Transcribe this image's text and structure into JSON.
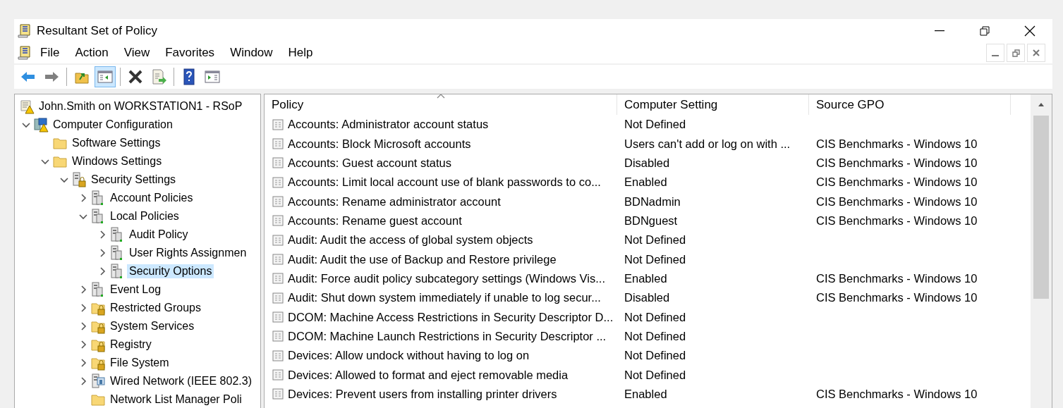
{
  "window": {
    "title": "Resultant Set of Policy"
  },
  "menu": [
    "File",
    "Action",
    "View",
    "Favorites",
    "Window",
    "Help"
  ],
  "toolbar": [
    [
      {
        "kind": "back",
        "selected": false
      },
      {
        "kind": "forward",
        "selected": false
      }
    ],
    [
      {
        "kind": "up",
        "selected": false
      },
      {
        "kind": "show-tree",
        "selected": true
      }
    ],
    [
      {
        "kind": "delete",
        "selected": false
      },
      {
        "kind": "export",
        "selected": false
      }
    ],
    [
      {
        "kind": "help",
        "selected": false
      },
      {
        "kind": "show-action",
        "selected": false
      }
    ]
  ],
  "tree": [
    {
      "label": "John.Smith on WORKSTATION1 - RSoP",
      "kind": "rsop",
      "selected": false,
      "children": [
        {
          "label": "Computer Configuration",
          "kind": "computer",
          "expanded": true,
          "selected": false,
          "children": [
            {
              "label": "Software Settings",
              "kind": "folder",
              "selected": false
            },
            {
              "label": "Windows Settings",
              "kind": "folder",
              "expanded": true,
              "selected": false,
              "children": [
                {
                  "label": "Security Settings",
                  "kind": "security",
                  "expanded": true,
                  "selected": false,
                  "children": [
                    {
                      "label": "Account Policies",
                      "kind": "policy",
                      "expanded": false,
                      "selected": false
                    },
                    {
                      "label": "Local Policies",
                      "kind": "policy",
                      "expanded": true,
                      "selected": false,
                      "children": [
                        {
                          "label": "Audit Policy",
                          "kind": "policy",
                          "expanded": false,
                          "selected": false
                        },
                        {
                          "label": "User Rights Assignmen",
                          "kind": "policy",
                          "expanded": false,
                          "selected": false
                        },
                        {
                          "label": "Security Options",
                          "kind": "policy",
                          "expanded": false,
                          "selected": true
                        }
                      ]
                    },
                    {
                      "label": "Event Log",
                      "kind": "policy",
                      "expanded": false,
                      "selected": false
                    },
                    {
                      "label": "Restricted Groups",
                      "kind": "locked-folder",
                      "expanded": false,
                      "selected": false
                    },
                    {
                      "label": "System Services",
                      "kind": "locked-folder",
                      "expanded": false,
                      "selected": false
                    },
                    {
                      "label": "Registry",
                      "kind": "locked-folder",
                      "expanded": false,
                      "selected": false
                    },
                    {
                      "label": "File System",
                      "kind": "locked-folder",
                      "expanded": false,
                      "selected": false
                    },
                    {
                      "label": "Wired Network (IEEE 802.3)",
                      "kind": "network",
                      "expanded": false,
                      "selected": false
                    },
                    {
                      "label": "Network List Manager Poli",
                      "kind": "folder",
                      "selected": false
                    }
                  ]
                }
              ]
            }
          ]
        }
      ]
    }
  ],
  "table": {
    "columns": [
      {
        "label": "Policy",
        "sorted": true
      },
      {
        "label": "Computer Setting",
        "sorted": false
      },
      {
        "label": "Source GPO",
        "sorted": false
      }
    ],
    "rows": [
      [
        "Accounts: Administrator account status",
        "Not Defined",
        ""
      ],
      [
        "Accounts: Block Microsoft accounts",
        "Users can't add or log on with ...",
        "CIS Benchmarks - Windows 10"
      ],
      [
        "Accounts: Guest account status",
        "Disabled",
        "CIS Benchmarks - Windows 10"
      ],
      [
        "Accounts: Limit local account use of blank passwords to co...",
        "Enabled",
        "CIS Benchmarks - Windows 10"
      ],
      [
        "Accounts: Rename administrator account",
        "BDNadmin",
        "CIS Benchmarks - Windows 10"
      ],
      [
        "Accounts: Rename guest account",
        "BDNguest",
        "CIS Benchmarks - Windows 10"
      ],
      [
        "Audit: Audit the access of global system objects",
        "Not Defined",
        ""
      ],
      [
        "Audit: Audit the use of Backup and Restore privilege",
        "Not Defined",
        ""
      ],
      [
        "Audit: Force audit policy subcategory settings (Windows Vis...",
        "Enabled",
        "CIS Benchmarks - Windows 10"
      ],
      [
        "Audit: Shut down system immediately if unable to log secur...",
        "Disabled",
        "CIS Benchmarks - Windows 10"
      ],
      [
        "DCOM: Machine Access Restrictions in Security Descriptor D...",
        "Not Defined",
        ""
      ],
      [
        "DCOM: Machine Launch Restrictions in Security Descriptor ...",
        "Not Defined",
        ""
      ],
      [
        "Devices: Allow undock without having to log on",
        "Not Defined",
        ""
      ],
      [
        "Devices: Allowed to format and eject removable media",
        "Not Defined",
        ""
      ],
      [
        "Devices: Prevent users from installing printer drivers",
        "Enabled",
        "CIS Benchmarks - Windows 10"
      ]
    ]
  }
}
